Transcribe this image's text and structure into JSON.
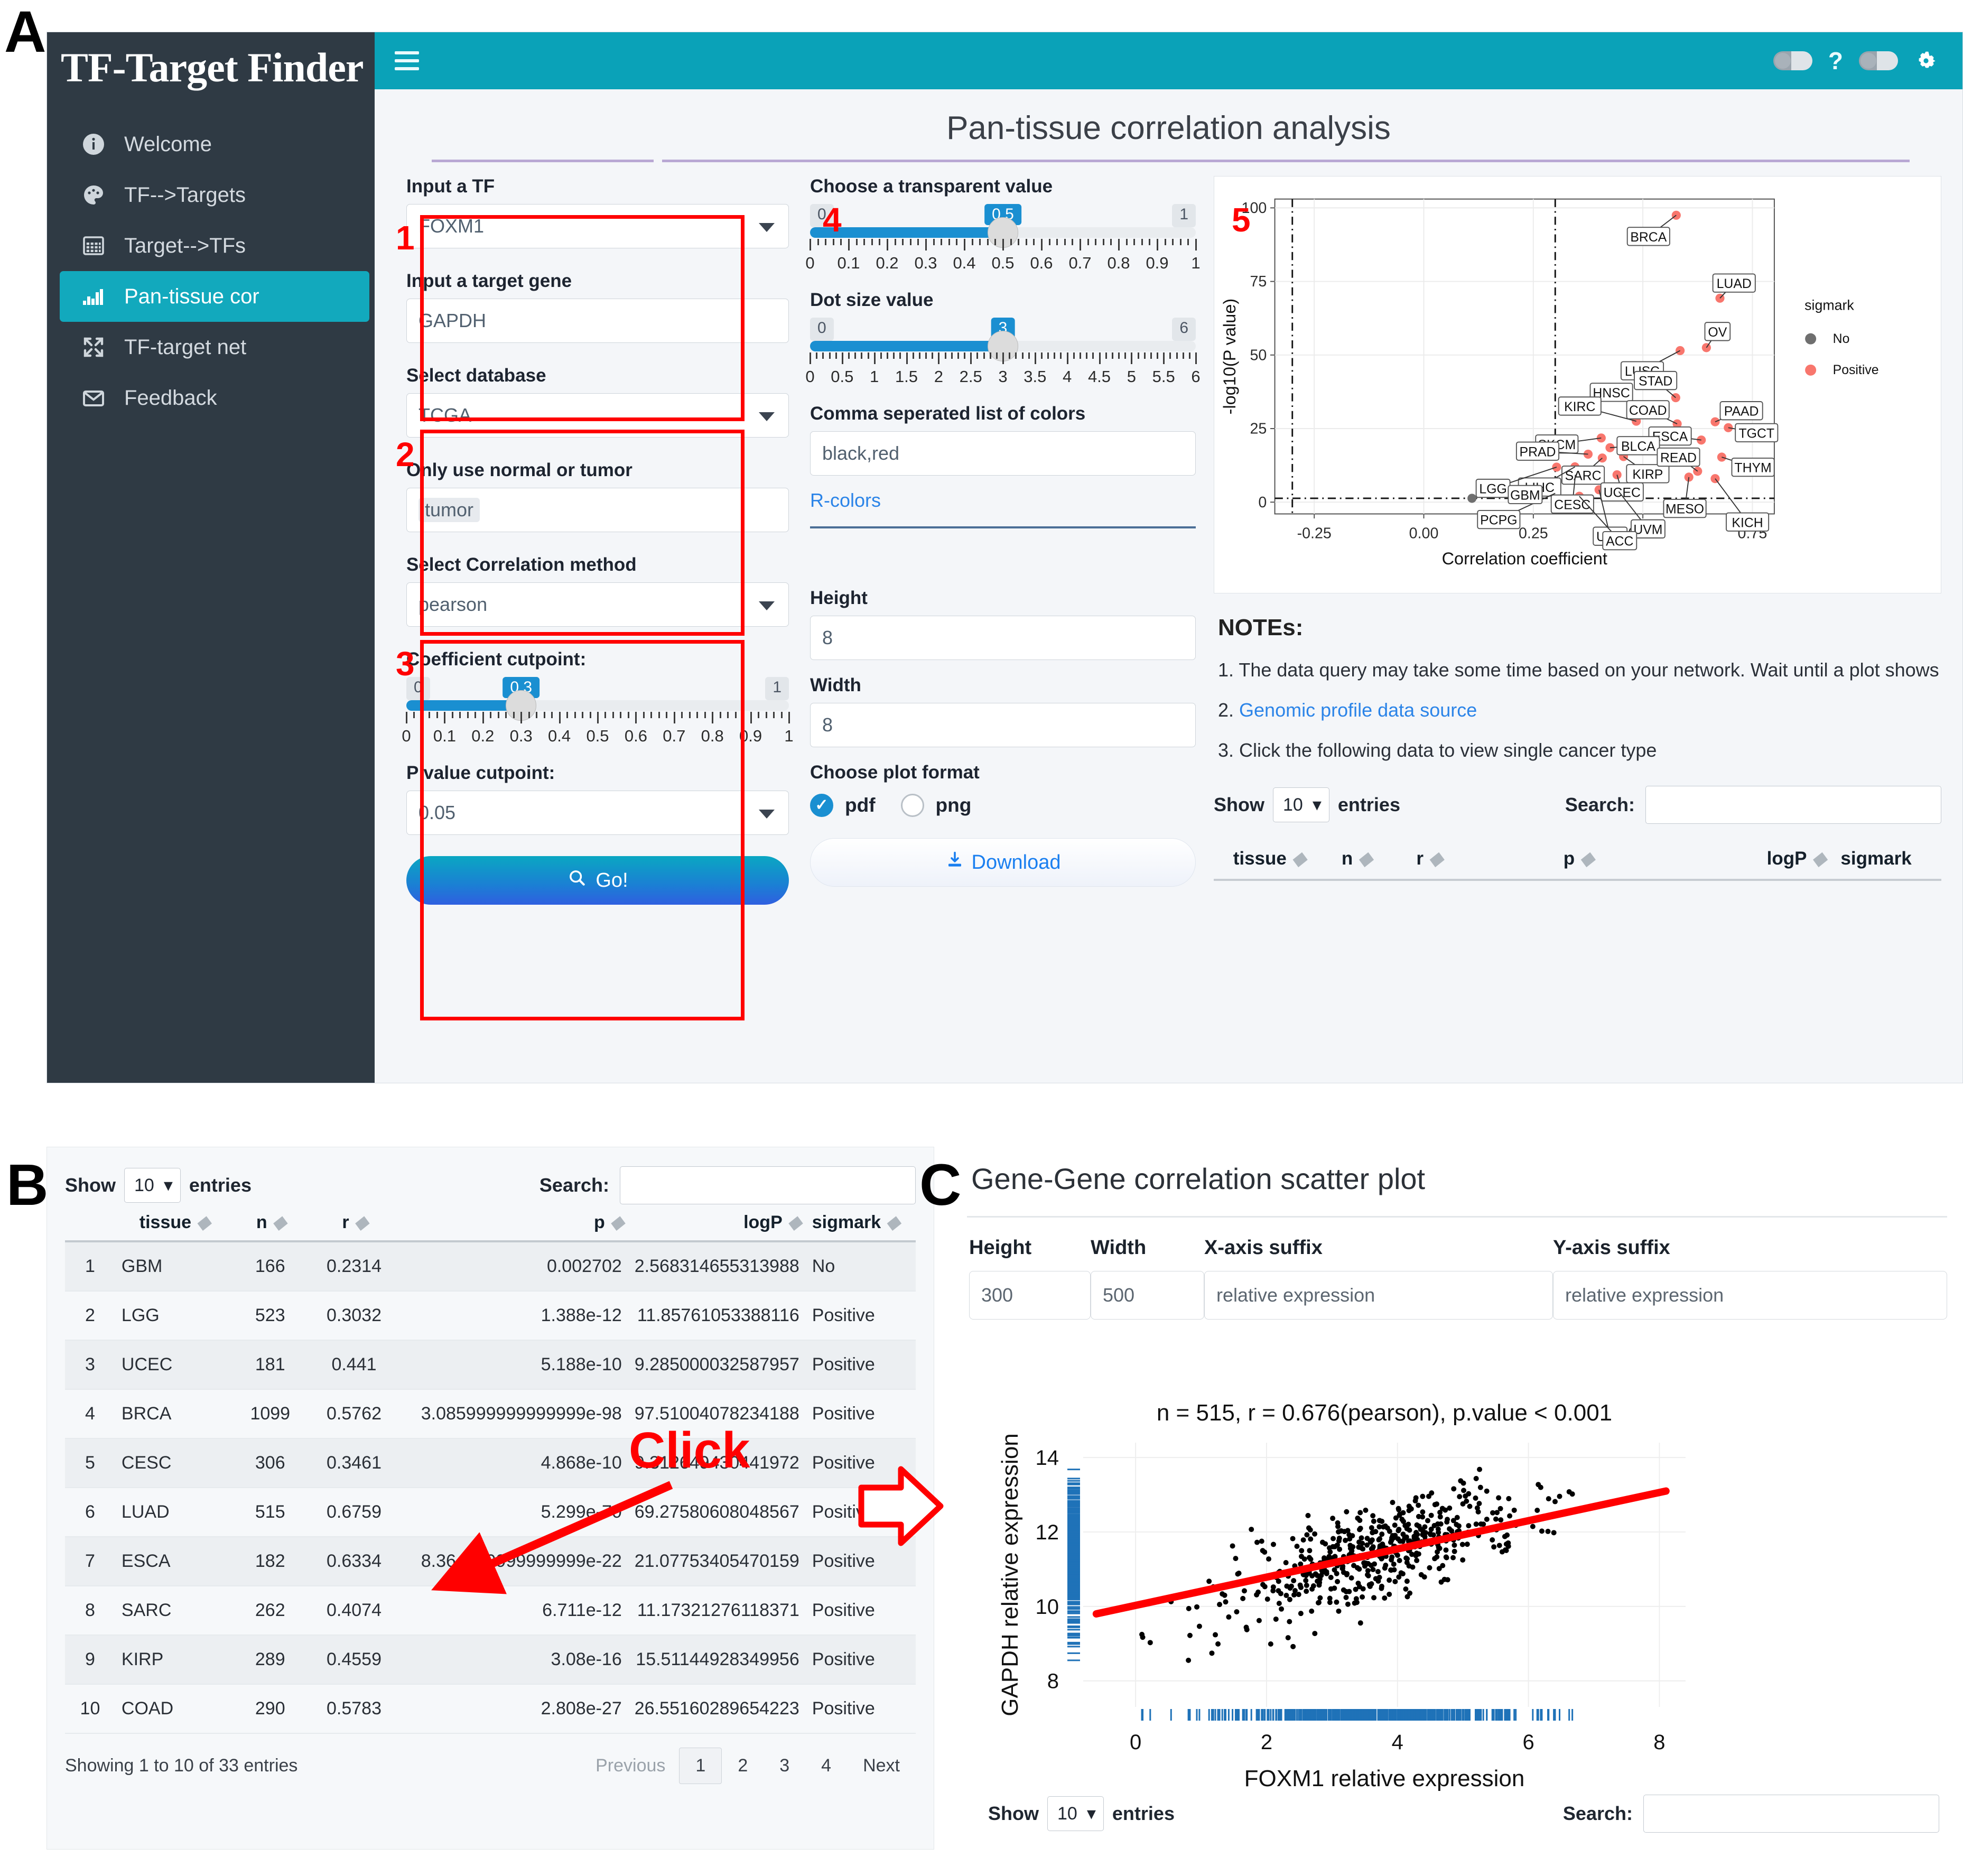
{
  "figure": {
    "panelA": "A",
    "panelB": "B",
    "panelC": "C"
  },
  "app": {
    "brand": "TF-Target Finder",
    "page_title": "Pan-tissue correlation analysis",
    "hamburger_icon": "hamburger-icon",
    "help_icon": "?",
    "gear_icon": "gear-icon"
  },
  "sidebar": {
    "items": [
      {
        "label": "Welcome",
        "icon": "info-icon",
        "active": false
      },
      {
        "label": "TF-->Targets",
        "icon": "palette-icon",
        "active": false
      },
      {
        "label": "Target-->TFs",
        "icon": "grid-icon",
        "active": false
      },
      {
        "label": "Pan-tissue cor",
        "icon": "bars-icon",
        "active": true
      },
      {
        "label": "TF-target net",
        "icon": "expand-icon",
        "active": false
      },
      {
        "label": "Feedback",
        "icon": "mail-icon",
        "active": false
      }
    ]
  },
  "annotations": {
    "numbers": [
      "1",
      "2",
      "3",
      "4",
      "5"
    ],
    "click_label": "Click"
  },
  "form": {
    "tf": {
      "label": "Input a TF",
      "value": "FOXM1"
    },
    "target_gene": {
      "label": "Input a target gene",
      "value": "GAPDH"
    },
    "database": {
      "label": "Select database",
      "value": "TCGA"
    },
    "sample_type": {
      "label": "Only use normal or tumor",
      "value": "tumor"
    },
    "cor_method": {
      "label": "Select Correlation method",
      "value": "pearson"
    },
    "coef_cutpoint": {
      "label": "Coefficient cutpoint:",
      "value": "0.3",
      "min": "0",
      "max": "1",
      "ticks": [
        "0",
        "0.1",
        "0.2",
        "0.3",
        "0.4",
        "0.5",
        "0.6",
        "0.7",
        "0.8",
        "0.9",
        "1"
      ]
    },
    "p_cutpoint": {
      "label": "P value cutpoint:",
      "value": "0.05"
    },
    "transparency": {
      "label": "Choose a transparent value",
      "value": "0.5",
      "min": "0",
      "max": "1",
      "ticks": [
        "0",
        "0.1",
        "0.2",
        "0.3",
        "0.4",
        "0.5",
        "0.6",
        "0.7",
        "0.8",
        "0.9",
        "1"
      ]
    },
    "dot_size": {
      "label": "Dot size value",
      "value": "3",
      "min": "0",
      "max": "6",
      "ticks": [
        "0",
        "0.5",
        "1",
        "1.5",
        "2",
        "2.5",
        "3",
        "3.5",
        "4",
        "4.5",
        "5",
        "5.5",
        "6"
      ]
    },
    "colors": {
      "label": "Comma seperated list of colors",
      "value": "black,red",
      "link": "R-colors"
    },
    "height": {
      "label": "Height",
      "value": "8"
    },
    "width": {
      "label": "Width",
      "value": "8"
    },
    "plot_format": {
      "label": "Choose plot format",
      "options": [
        "pdf",
        "png"
      ],
      "selected": "pdf"
    },
    "go_button": "Go!",
    "download_button": "Download"
  },
  "notes": {
    "heading": "NOTEs:",
    "items": [
      "1. The data query may take some time based on your network. Wait until a plot shows",
      "2. Genomic profile data source",
      "3. Click the following data to view single cancer type"
    ],
    "link_text": "Genomic profile data source"
  },
  "datatable_a": {
    "show_label": "Show",
    "entries_label": "entries",
    "page_size": "10",
    "search_label": "Search:",
    "search_value": "",
    "columns": [
      "tissue",
      "n",
      "r",
      "p",
      "logP",
      "sigmark"
    ]
  },
  "panelB": {
    "show_label": "Show",
    "entries_label": "entries",
    "page_size": "10",
    "search_label": "Search:",
    "search_value": "",
    "columns": [
      "",
      "tissue",
      "n",
      "r",
      "p",
      "logP",
      "sigmark"
    ],
    "rows": [
      [
        "1",
        "GBM",
        "166",
        "0.2314",
        "0.002702",
        "2.568314655313988",
        "No"
      ],
      [
        "2",
        "LGG",
        "523",
        "0.3032",
        "1.388e-12",
        "11.85761053388116",
        "Positive"
      ],
      [
        "3",
        "UCEC",
        "181",
        "0.441",
        "5.188e-10",
        "9.285000032587957",
        "Positive"
      ],
      [
        "4",
        "BRCA",
        "1099",
        "0.5762",
        "3.085999999999999e-98",
        "97.51004078234188",
        "Positive"
      ],
      [
        "5",
        "CESC",
        "306",
        "0.3461",
        "4.868e-10",
        "9.312649430441972",
        "Positive"
      ],
      [
        "6",
        "LUAD",
        "515",
        "0.6759",
        "5.299e-70",
        "69.27580608048567",
        "Positive"
      ],
      [
        "7",
        "ESCA",
        "182",
        "0.6334",
        "8.364999999999999e-22",
        "21.07753405470159",
        "Positive"
      ],
      [
        "8",
        "SARC",
        "262",
        "0.4074",
        "6.711e-12",
        "11.17321276118371",
        "Positive"
      ],
      [
        "9",
        "KIRP",
        "289",
        "0.4559",
        "3.08e-16",
        "15.51144928349956",
        "Positive"
      ],
      [
        "10",
        "COAD",
        "290",
        "0.5783",
        "2.808e-27",
        "26.55160289654223",
        "Positive"
      ]
    ],
    "info": "Showing 1 to 10 of 33 entries",
    "previous": "Previous",
    "next": "Next",
    "pages": [
      "1",
      "2",
      "3",
      "4"
    ]
  },
  "panelC": {
    "title": "Gene-Gene correlation scatter plot",
    "fields": [
      {
        "label": "Height",
        "value": "300"
      },
      {
        "label": "Width",
        "value": "500"
      },
      {
        "label": "X-axis suffix",
        "value": "relative expression"
      },
      {
        "label": "Y-axis suffix",
        "value": "relative expression"
      }
    ],
    "show_label": "Show",
    "entries_label": "entries",
    "page_size": "10",
    "search_label": "Search:",
    "search_value": ""
  },
  "chart_data": [
    {
      "id": "volcano",
      "type": "scatter",
      "title": "",
      "xlabel": "Correlation coefficient",
      "ylabel": "-log10(P value)",
      "xlim": [
        -0.34,
        0.8
      ],
      "ylim": [
        -4,
        103
      ],
      "xticks": [
        "-0.25",
        "0.00",
        "0.25",
        "0.50",
        "0.75"
      ],
      "yticks": [
        "0",
        "25",
        "50",
        "75",
        "100"
      ],
      "grid": true,
      "legend": {
        "title": "sigmark",
        "position": "right",
        "entries": [
          {
            "label": "No",
            "color": "#6f6f6f"
          },
          {
            "label": "Positive",
            "color": "#f8766d"
          }
        ]
      },
      "reference_lines": {
        "vertical": [
          -0.3,
          0.3
        ],
        "horizontal": [
          1.3
        ]
      },
      "points": [
        {
          "label": "BRCA",
          "x": 0.5762,
          "y": 97.5,
          "sig": "Positive"
        },
        {
          "label": "LUAD",
          "x": 0.6759,
          "y": 69.3,
          "sig": "Positive"
        },
        {
          "label": "OV",
          "x": 0.645,
          "y": 52.5,
          "sig": "Positive"
        },
        {
          "label": "LUSC",
          "x": 0.585,
          "y": 51.5,
          "sig": "Positive"
        },
        {
          "label": "STAD",
          "x": 0.575,
          "y": 35.5,
          "sig": "Positive"
        },
        {
          "label": "HNSC",
          "x": 0.495,
          "y": 31.5,
          "sig": "Positive"
        },
        {
          "label": "KIRC",
          "x": 0.485,
          "y": 27.5,
          "sig": "Positive"
        },
        {
          "label": "COAD",
          "x": 0.5783,
          "y": 26.6,
          "sig": "Positive"
        },
        {
          "label": "PAAD",
          "x": 0.665,
          "y": 27.3,
          "sig": "Positive"
        },
        {
          "label": "TGCT",
          "x": 0.695,
          "y": 25.3,
          "sig": "Positive"
        },
        {
          "label": "SKCM",
          "x": 0.405,
          "y": 21.8,
          "sig": "Positive"
        },
        {
          "label": "ESCA",
          "x": 0.6334,
          "y": 21.1,
          "sig": "Positive"
        },
        {
          "label": "BLCA",
          "x": 0.425,
          "y": 18.5,
          "sig": "Positive"
        },
        {
          "label": "PRAD",
          "x": 0.375,
          "y": 16.3,
          "sig": "Positive"
        },
        {
          "label": "THYM",
          "x": 0.68,
          "y": 15.3,
          "sig": "Positive"
        },
        {
          "label": "SARC",
          "x": 0.4074,
          "y": 15.0,
          "sig": "Positive"
        },
        {
          "label": "KIRP",
          "x": 0.4559,
          "y": 15.5,
          "sig": "Positive"
        },
        {
          "label": "LIHC",
          "x": 0.345,
          "y": 12.0,
          "sig": "Positive"
        },
        {
          "label": "LGG",
          "x": 0.3032,
          "y": 11.9,
          "sig": "Positive"
        },
        {
          "label": "READ",
          "x": 0.625,
          "y": 10.5,
          "sig": "Positive"
        },
        {
          "label": "MESO",
          "x": 0.605,
          "y": 8.5,
          "sig": "Positive"
        },
        {
          "label": "KICH",
          "x": 0.665,
          "y": 8.0,
          "sig": "Positive"
        },
        {
          "label": "UCEC",
          "x": 0.441,
          "y": 9.3,
          "sig": "Positive"
        },
        {
          "label": "CESC",
          "x": 0.3461,
          "y": 9.3,
          "sig": "Positive"
        },
        {
          "label": "UCS",
          "x": 0.4,
          "y": 4.2,
          "sig": "Positive"
        },
        {
          "label": "UVM",
          "x": 0.445,
          "y": 3.6,
          "sig": "Positive"
        },
        {
          "label": "ACC",
          "x": 0.355,
          "y": 2.0,
          "sig": "Positive"
        },
        {
          "label": "PCPG",
          "x": 0.3,
          "y": 3.0,
          "sig": "Positive"
        },
        {
          "label": "GBM",
          "x": 0.2314,
          "y": 2.57,
          "sig": "No"
        },
        {
          "label": "",
          "x": 0.11,
          "y": 1.3,
          "sig": "No"
        },
        {
          "label": "",
          "x": 0.3,
          "y": 0.6,
          "sig": "No"
        }
      ]
    },
    {
      "id": "scatter",
      "type": "scatter",
      "title": "n = 515, r = 0.676(pearson), p.value < 0.001",
      "xlabel": "FOXM1 relative expression",
      "ylabel": "GAPDH relative expression",
      "xlim": [
        -0.8,
        8.4
      ],
      "ylim": [
        7.3,
        14.4
      ],
      "xticks": [
        "0",
        "2",
        "4",
        "6",
        "8"
      ],
      "yticks": [
        "8",
        "10",
        "12",
        "14"
      ],
      "n": 515,
      "r": 0.676,
      "method": "pearson",
      "p_value": "< 0.001",
      "fit_line": {
        "color": "#ff0000",
        "x0": -0.6,
        "y0": 9.8,
        "x1": 8.1,
        "y1": 13.1
      },
      "rug_color": "#1f72b8",
      "point_color": "#000000"
    }
  ]
}
